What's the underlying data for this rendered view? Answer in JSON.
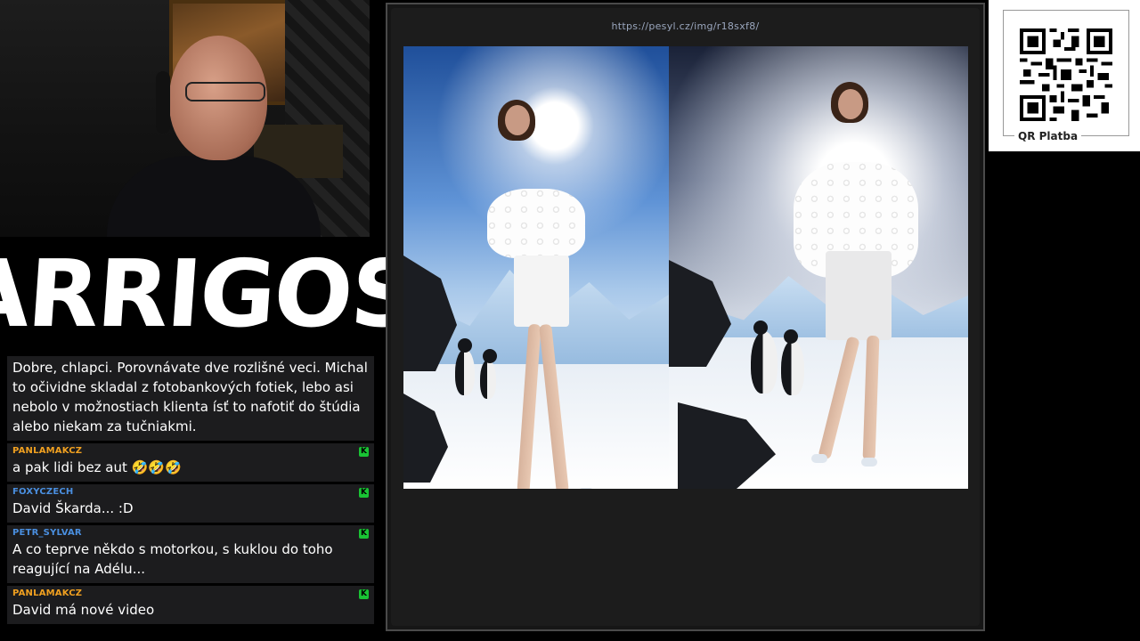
{
  "logo": {
    "text": "ARRIGOS"
  },
  "browser": {
    "url": "https://pesyl.cz/img/r18sxf8/"
  },
  "qr": {
    "label": "QR Platba"
  },
  "chat": {
    "main_message": "Dobre, chlapci. Porovnávate dve rozlišné veci. Michal to očividne skladal z fotobankových fotiek, lebo asi nebolo v možnostiach klienta ísť to nafotiť do štúdia alebo niekam za tučniakmi.",
    "messages": [
      {
        "user": "PANLAMAKCZ",
        "user_color": "#f0a020",
        "text": "a pak lidi bez aut 🤣🤣🤣"
      },
      {
        "user": "FOXYCZECH",
        "user_color": "#4a8fe0",
        "text": "David Škarda... :D"
      },
      {
        "user": "PETR_SYLVAR",
        "user_color": "#4a8fe0",
        "text": "A co teprve někdo s motorkou, s kuklou do toho reagující na Adélu..."
      },
      {
        "user": "PANLAMAKCZ",
        "user_color": "#f0a020",
        "text": "David má nové video"
      }
    ],
    "badge_color": "#19c334"
  }
}
